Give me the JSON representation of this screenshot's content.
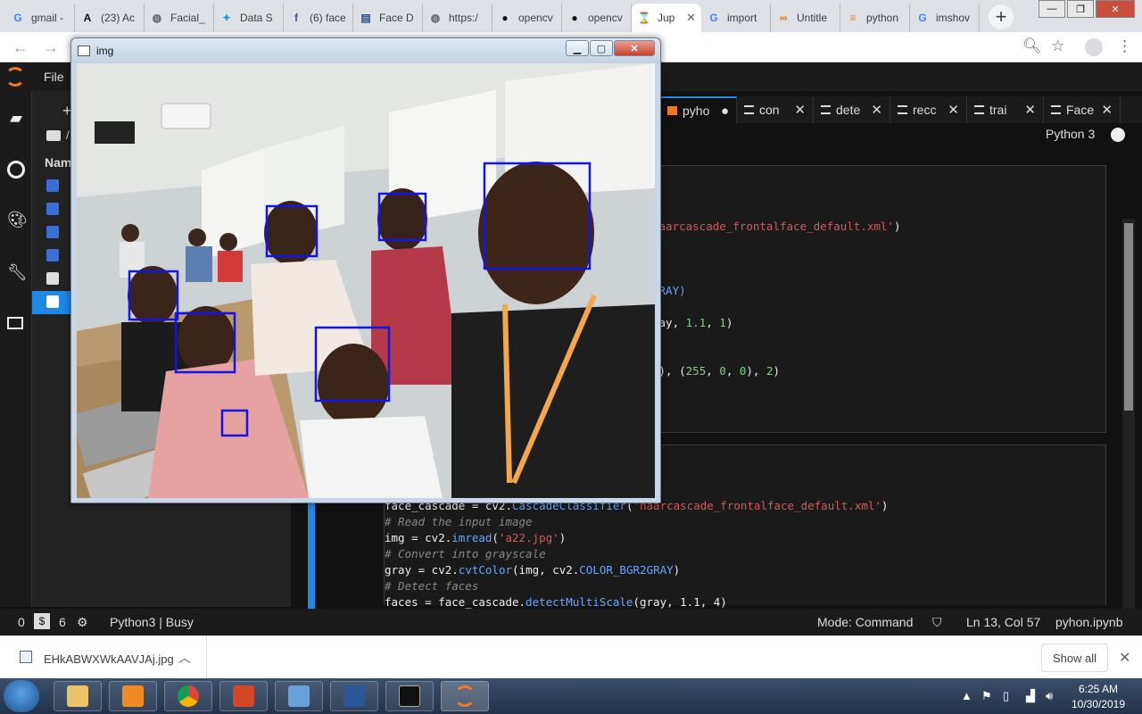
{
  "browser": {
    "tabs": [
      {
        "label": "gmail -",
        "icon": "google-icon",
        "color": "#4285f4",
        "glyph": "G"
      },
      {
        "label": "(23) Ac",
        "icon": "font-a-icon",
        "color": "#111111",
        "glyph": "A"
      },
      {
        "label": "Facial_",
        "icon": "globe-icon",
        "color": "#5f6368",
        "glyph": "◍"
      },
      {
        "label": "Data S",
        "icon": "twitter-icon",
        "color": "#1da1f2",
        "glyph": "✦"
      },
      {
        "label": "(6) face",
        "icon": "facebook-icon",
        "color": "#3b5998",
        "glyph": "f"
      },
      {
        "label": "Face D",
        "icon": "document-icon",
        "color": "#2d4a8a",
        "glyph": "▤"
      },
      {
        "label": "https:/",
        "icon": "globe-icon",
        "color": "#5f6368",
        "glyph": "◍"
      },
      {
        "label": "opencv",
        "icon": "github-icon",
        "color": "#111111",
        "glyph": "●"
      },
      {
        "label": "opencv",
        "icon": "github-icon",
        "color": "#111111",
        "glyph": "●"
      },
      {
        "label": "Jup",
        "icon": "hourglass-icon",
        "color": "#f37726",
        "glyph": "⌛"
      },
      {
        "label": "import",
        "icon": "google-icon",
        "color": "#4285f4",
        "glyph": "G"
      },
      {
        "label": "Untitle",
        "icon": "colab-icon",
        "color": "#e8710a",
        "glyph": "∞"
      },
      {
        "label": "python",
        "icon": "stackoverflow-icon",
        "color": "#f48024",
        "glyph": "≡"
      },
      {
        "label": "imshov",
        "icon": "google-icon",
        "color": "#4285f4",
        "glyph": "G"
      }
    ],
    "active_tab_index": 9,
    "new_tab": "+"
  },
  "jupyter": {
    "menu_file": "File",
    "file_header": "Nam",
    "breadcrumb": "/",
    "notebook_tabs": [
      {
        "label": "pyho",
        "active": true
      },
      {
        "label": "con",
        "active": false
      },
      {
        "label": "dete",
        "active": false
      },
      {
        "label": "recc",
        "active": false
      },
      {
        "label": "trai",
        "active": false
      },
      {
        "label": "Face",
        "active": false
      }
    ],
    "kernel": "Python 3",
    "cell1_fragments": {
      "line_xml": "haarcascade_frontalface_default.xml'",
      "line_gray": "GRAY)",
      "line_detect_prefix": "ray, ",
      "line_detect_n1": "1.1",
      "line_detect_sep": ", ",
      "line_detect_n2": "1",
      "line_rect_prefix": "h), (",
      "line_rect_n1": "255",
      "line_rect_n2": "0",
      "line_rect_n3": "0",
      "line_rect_n4": "2"
    },
    "cell2": {
      "line1_prefix": "face_cascade = cv2.",
      "line1_fn": "CascadeClassifier",
      "line1_str": "'haarcascade_frontalface_default.xml'",
      "comment_read": "# Read the input image",
      "line_read_prefix": "img = cv2.",
      "line_read_fn": "imread",
      "line_read_str": "'a22.jpg'",
      "comment_gray": "# Convert into grayscale",
      "line_gray_prefix": "gray = cv2.",
      "line_gray_fn": "cvtColor",
      "line_gray_mid": "(img, cv2.",
      "line_gray_const": "COLOR_BGR2GRAY",
      "comment_detect": "# Detect faces",
      "line_detect_prefix": "faces = face_cascade.",
      "line_detect_fn": "detectMultiScale",
      "line_detect_args": "(gray, 1.1, 4)"
    },
    "status": {
      "count_a": "0",
      "count_b": "6",
      "kernel_state": "Python3 | Busy",
      "mode": "Mode: Command",
      "position": "Ln 13, Col 57",
      "filename": "pyhon.ipynb"
    }
  },
  "cv_window": {
    "title": "img",
    "min": "▁",
    "max": "▢",
    "close": "✕"
  },
  "download": {
    "filename": "EHkABWXWkAAVJAj.jpg",
    "show_all": "Show all"
  },
  "taskbar": {
    "time": "6:25 AM",
    "date": "10/30/2019"
  }
}
